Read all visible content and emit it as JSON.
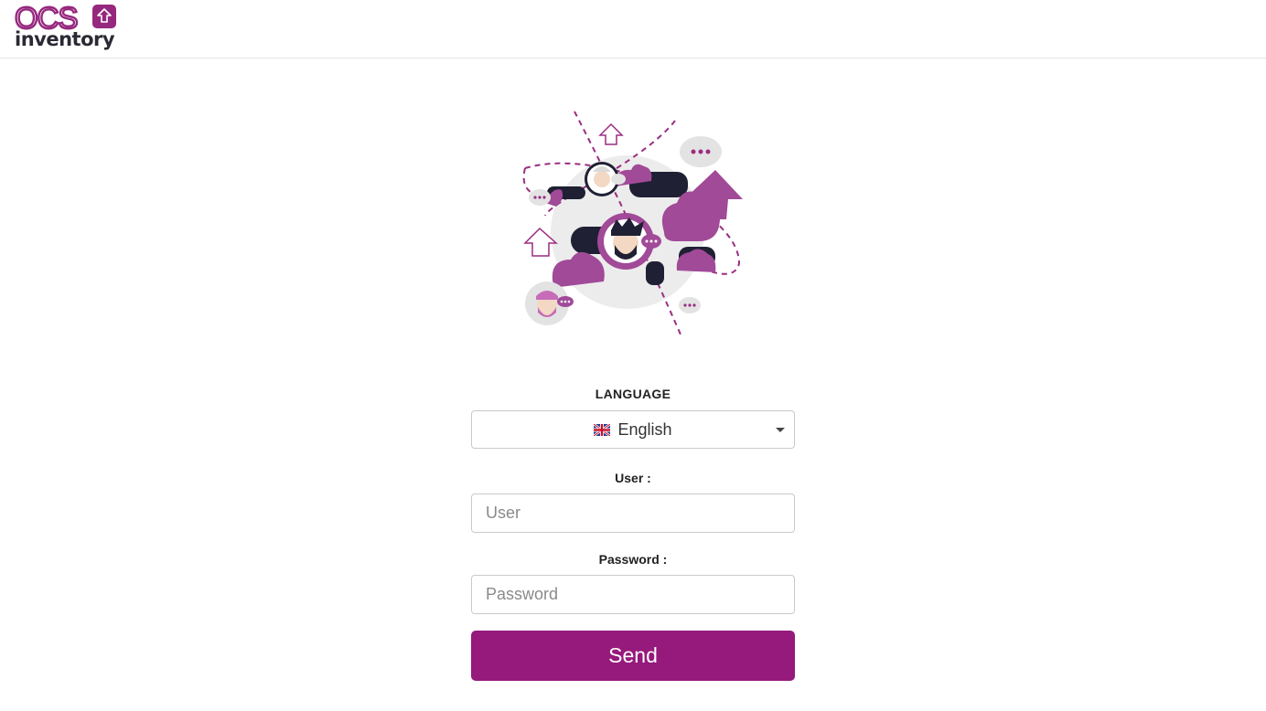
{
  "header": {
    "logo_top": "OCS",
    "logo_bottom": "inventory",
    "brand_color": "#96297e"
  },
  "illustration": {
    "icon": "community-illustration"
  },
  "login": {
    "language_label": "LANGUAGE",
    "language_selected": "English",
    "language_flag_icon": "uk-flag-icon",
    "user_label": "User :",
    "user_placeholder": "User",
    "user_value": "",
    "password_label": "Password :",
    "password_placeholder": "Password",
    "password_value": "",
    "send_label": "Send",
    "button_color": "#96197c"
  }
}
